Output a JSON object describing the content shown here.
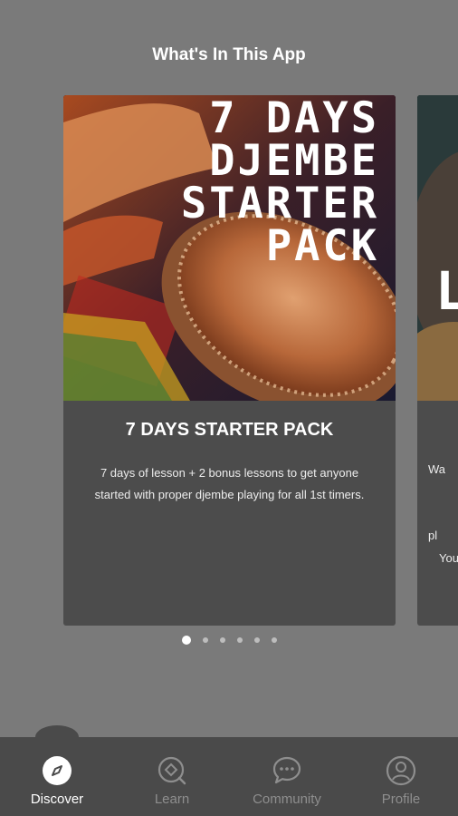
{
  "header": {
    "title": "What's In This App"
  },
  "carousel": {
    "cards": [
      {
        "image_overlay_lines": [
          "7 DAYS",
          "DJEMBE",
          "STARTER",
          "PACK"
        ],
        "title": "7 DAYS STARTER PACK",
        "description": "7 days of lesson + 2 bonus lessons to get anyone started with proper djembe playing for all 1st timers."
      },
      {
        "image_overlay_text": "L",
        "text_fragments": [
          "Wa",
          "pl",
          "You"
        ]
      }
    ],
    "page_count": 6,
    "active_page": 1
  },
  "tabbar": {
    "tabs": [
      {
        "label": "Discover",
        "icon": "compass-icon",
        "active": true
      },
      {
        "label": "Learn",
        "icon": "learn-icon",
        "active": false
      },
      {
        "label": "Community",
        "icon": "chat-bubble-icon",
        "active": false
      },
      {
        "label": "Profile",
        "icon": "profile-icon",
        "active": false
      }
    ]
  },
  "colors": {
    "background": "#7a7a7a",
    "card": "#4c4c4c",
    "tabbar": "#4a4a4a",
    "active": "#ffffff",
    "inactive": "#8e8e8e"
  }
}
